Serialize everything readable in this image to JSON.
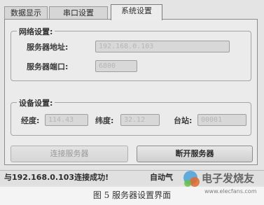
{
  "tabs": [
    {
      "label": "数据显示",
      "active": false
    },
    {
      "label": "串口设置",
      "active": false
    },
    {
      "label": "系统设置",
      "active": true
    }
  ],
  "network_group": {
    "title": "网络设置:",
    "server_address_label": "服务器地址:",
    "server_address_value": "192.168.0.103",
    "server_port_label": "服务器端口:",
    "server_port_value": "6800"
  },
  "device_group": {
    "title": "设备设置:",
    "longitude_label": "经度:",
    "longitude_value": "114.43",
    "latitude_label": "纬度:",
    "latitude_value": "32.12",
    "station_label": "台站:",
    "station_value": "00001"
  },
  "buttons": {
    "connect": "连接服务器",
    "disconnect": "断开服务器"
  },
  "status": {
    "message": "与192.168.0.103连接成功!",
    "right_text": "自动气"
  },
  "caption": "图 5   服务器设置界面",
  "watermark": {
    "brand": "电子发烧友",
    "url": "www.elecfans.com"
  }
}
